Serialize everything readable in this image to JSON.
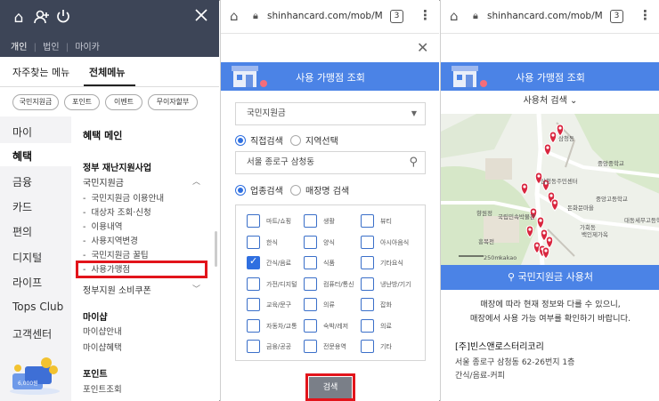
{
  "panel1": {
    "top_icons": [
      "home-icon",
      "add-person-icon",
      "power-icon",
      "close-icon"
    ],
    "modes": [
      "개인",
      "법인",
      "마이카"
    ],
    "menu_tabs": [
      "자주찾는 메뉴",
      "전체메뉴"
    ],
    "chips": [
      "국민지원금",
      "포인트",
      "이벤트",
      "무이자할부"
    ],
    "left_nav": [
      "마이",
      "혜택",
      "금융",
      "카드",
      "편의",
      "디지털",
      "라이프",
      "Tops Club",
      "고객센터"
    ],
    "content": {
      "heading": "혜택 메인",
      "section1": "정부 재난지원사업",
      "group1": "국민지원금",
      "sub_items": [
        "국민지원금 이용안내",
        "대상자 조회·신청",
        "이용내역",
        "사용지역변경",
        "국민지원금 꿀팁",
        "사용가맹점"
      ],
      "group2": "정부지원 소비쿠폰",
      "section2": "마이샵",
      "section2_items": [
        "마이샵안내",
        "마이샵혜택"
      ],
      "section3": "포인트",
      "section3_items": [
        "포인트조회"
      ]
    },
    "promo_amount": "6,000원"
  },
  "browser": {
    "url": "shinhancard.com/mob/M",
    "tab_count": "3"
  },
  "panel2": {
    "banner_title": "사용 가맹점 조회",
    "select_value": "국민지원금",
    "radio_row1": [
      "직접검색",
      "지역선택"
    ],
    "search_value": "서울 종로구 삼청동",
    "radio_row2": [
      "업종검색",
      "매장명 검색"
    ],
    "categories": [
      [
        "마트/쇼핑",
        "생활",
        "뷰티"
      ],
      [
        "한식",
        "양식",
        "아시아음식"
      ],
      [
        "간식/음료",
        "식품",
        "기타요식"
      ],
      [
        "가전/디지털",
        "컴퓨터/통신",
        "냉난방/기기"
      ],
      [
        "교육/문구",
        "의류",
        "잡화"
      ],
      [
        "자동차/교통",
        "숙박/레저",
        "의료"
      ],
      [
        "금융/공공",
        "전문용역",
        "기타"
      ]
    ],
    "checked_category": "간식/음료",
    "search_button": "검색"
  },
  "panel3": {
    "banner_title": "사용 가맹점 조회",
    "search_toggle": "사용처 검색",
    "map_labels": [
      "삼청동",
      "중앙중학교",
      "중앙고등학교",
      "국립민속박물관",
      "흥복전",
      "가회동",
      "백인제가옥",
      "대동세무고등학교",
      "삼청동주민센터",
      "돈화문마을",
      "향원정",
      "250m",
      "kakao"
    ],
    "bar_label": "국민지원금 사용처",
    "notice_line1": "매장에 따라 현재 정보와 다를 수 있으니,",
    "notice_line2": "매장에서 사용 가능 여부를 확인하기 바랍니다.",
    "store_name": "[주]빈스앤로스터리코리",
    "store_address": "서울 종로구 삼청동 62-26번지 1층",
    "store_category": "간식/음료-커피"
  },
  "colors": {
    "header_dark": "#3d4557",
    "accent_blue": "#4b83e6",
    "highlight_red": "#e2141b",
    "pin_red": "#d9263f"
  }
}
